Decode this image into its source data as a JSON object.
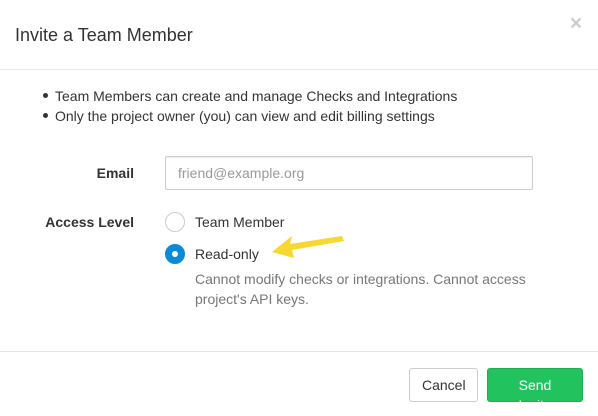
{
  "dialog": {
    "title": "Invite a Team Member",
    "close_glyph": "×"
  },
  "info": {
    "bullets": [
      "Team Members can create and manage Checks and Integrations",
      "Only the project owner (you) can view and edit billing settings"
    ]
  },
  "form": {
    "email_label": "Email",
    "email_placeholder": "friend@example.org",
    "email_value": "",
    "access_label": "Access Level",
    "options": [
      {
        "label": "Team Member",
        "selected": false
      },
      {
        "label": "Read-only",
        "selected": true
      }
    ],
    "readonly_help": "Cannot modify checks or integrations. Cannot access project's API keys."
  },
  "footer": {
    "cancel_label": "Cancel",
    "send_label": "Send Invite"
  },
  "colors": {
    "primary_radio": "#0b8bd6",
    "send_button": "#22c35e",
    "annotation_arrow": "#f7d731"
  },
  "icons": {
    "close": "close-icon",
    "annotation": "arrow-annotation-icon"
  }
}
